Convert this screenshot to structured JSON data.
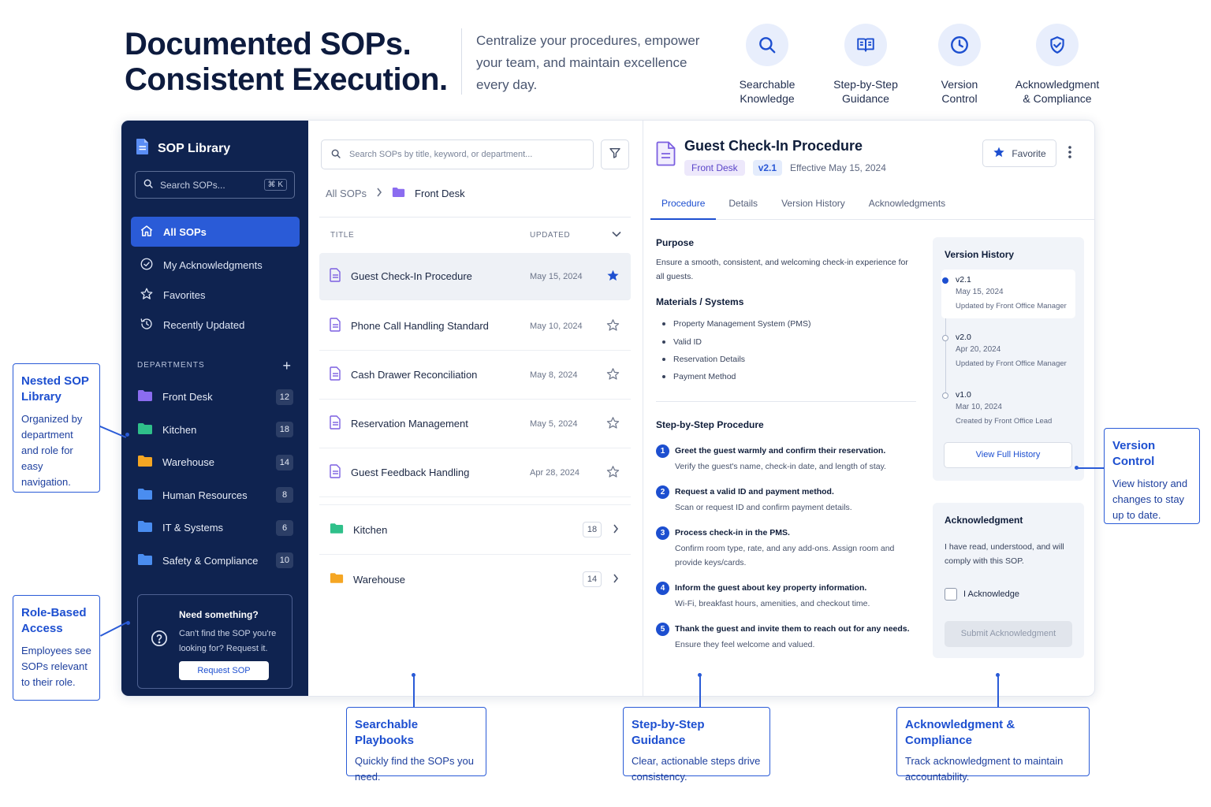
{
  "hero": {
    "title_line1": "Documented SOPs.",
    "title_line2": "Consistent Execution.",
    "tagline": "Centralize your procedures, empower your team, and maintain excellence every day.",
    "features": [
      {
        "label": "Searchable\nKnowledge",
        "icon": "search-icon"
      },
      {
        "label": "Step-by-Step\nGuidance",
        "icon": "book-icon"
      },
      {
        "label": "Version\nControl",
        "icon": "clock-icon"
      },
      {
        "label": "Acknowledgment\n& Compliance",
        "icon": "shield-check-icon"
      }
    ]
  },
  "sidebar": {
    "brand": "SOP Library",
    "search_placeholder": "Search SOPs...",
    "search_shortcut": "⌘ K",
    "nav": [
      {
        "label": "All SOPs",
        "icon": "home-icon",
        "active": true
      },
      {
        "label": "My Acknowledgments",
        "icon": "check-circle-icon"
      },
      {
        "label": "Favorites",
        "icon": "star-icon"
      },
      {
        "label": "Recently Updated",
        "icon": "history-icon"
      }
    ],
    "departments_heading": "DEPARTMENTS",
    "departments": [
      {
        "label": "Front Desk",
        "count": "12",
        "color": "#8b6cf0"
      },
      {
        "label": "Kitchen",
        "count": "18",
        "color": "#2fc08a"
      },
      {
        "label": "Warehouse",
        "count": "14",
        "color": "#f5a623"
      },
      {
        "label": "Human Resources",
        "count": "8",
        "color": "#4a8df0"
      },
      {
        "label": "IT & Systems",
        "count": "6",
        "color": "#4a8df0"
      },
      {
        "label": "Safety & Compliance",
        "count": "10",
        "color": "#4a8df0"
      }
    ],
    "help": {
      "title": "Need something?",
      "text": "Can't find the SOP you're looking for? Request it.",
      "button": "Request SOP"
    }
  },
  "list": {
    "search_placeholder": "Search SOPs by title, keyword, or department...",
    "breadcrumb_root": "All SOPs",
    "breadcrumb_current": "Front Desk",
    "col_title": "TITLE",
    "col_updated": "UPDATED",
    "rows": [
      {
        "title": "Guest Check-In Procedure",
        "date": "May 15, 2024",
        "favorite": true
      },
      {
        "title": "Phone Call Handling Standard",
        "date": "May 10, 2024",
        "favorite": false
      },
      {
        "title": "Cash Drawer Reconciliation",
        "date": "May 8, 2024",
        "favorite": false
      },
      {
        "title": "Reservation Management",
        "date": "May 5, 2024",
        "favorite": false
      },
      {
        "title": "Guest Feedback Handling",
        "date": "Apr 28, 2024",
        "favorite": false
      }
    ],
    "folders": [
      {
        "label": "Kitchen",
        "count": "18",
        "color": "#2fc08a"
      },
      {
        "label": "Warehouse",
        "count": "14",
        "color": "#f5a623"
      }
    ]
  },
  "detail": {
    "title": "Guest Check-In Procedure",
    "department": "Front Desk",
    "version": "v2.1",
    "effective": "Effective May 15, 2024",
    "favorite_label": "Favorite",
    "tabs": [
      "Procedure",
      "Details",
      "Version History",
      "Acknowledgments"
    ],
    "purpose_title": "Purpose",
    "purpose_text": "Ensure a smooth, consistent, and welcoming check-in experience for all guests.",
    "materials_title": "Materials / Systems",
    "materials": [
      "Property Management System (PMS)",
      "Valid ID",
      "Reservation Details",
      "Payment Method"
    ],
    "steps_title": "Step-by-Step Procedure",
    "steps": [
      {
        "n": "1",
        "title": "Greet the guest warmly and confirm their reservation.",
        "desc": "Verify the guest's name, check-in date, and length of stay."
      },
      {
        "n": "2",
        "title": "Request a valid ID and payment method.",
        "desc": "Scan or request ID and confirm payment details."
      },
      {
        "n": "3",
        "title": "Process check-in in the PMS.",
        "desc": "Confirm room type, rate, and any add-ons. Assign room and provide keys/cards."
      },
      {
        "n": "4",
        "title": "Inform the guest about key property information.",
        "desc": "Wi-Fi, breakfast hours, amenities, and checkout time."
      },
      {
        "n": "5",
        "title": "Thank the guest and invite them to reach out for any needs.",
        "desc": "Ensure they feel welcome and valued."
      }
    ],
    "version_history": {
      "title": "Version History",
      "items": [
        {
          "version": "v2.1",
          "date": "May 15, 2024",
          "by": "Updated by Front Office Manager",
          "current": true
        },
        {
          "version": "v2.0",
          "date": "Apr 20, 2024",
          "by": "Updated by Front Office Manager",
          "current": false
        },
        {
          "version": "v1.0",
          "date": "Mar 10, 2024",
          "by": "Created by Front Office Lead",
          "current": false
        }
      ],
      "button": "View Full History"
    },
    "acknowledgment": {
      "title": "Acknowledgment",
      "text": "I have read, understood, and will comply with this SOP.",
      "checkbox_label": "I Acknowledge",
      "button": "Submit Acknowledgment"
    }
  },
  "callouts": {
    "nested": {
      "title": "Nested SOP Library",
      "text": "Organized by department and role for easy navigation."
    },
    "role": {
      "title": "Role-Based Access",
      "text": "Employees see SOPs relevant to their role."
    },
    "version": {
      "title": "Version Control",
      "text": "View history and changes to stay up to date."
    },
    "playbooks": {
      "title": "Searchable Playbooks",
      "text": "Quickly find the SOPs you need."
    },
    "steps": {
      "title": "Step-by-Step Guidance",
      "text": "Clear, actionable steps drive consistency."
    },
    "ack": {
      "title": "Acknowledgment & Compliance",
      "text": "Track acknowledgment to maintain accountability."
    }
  },
  "colors": {
    "accent": "#1d4fd0",
    "sidebar": "#0f2350",
    "title": "#0d1b3e"
  }
}
